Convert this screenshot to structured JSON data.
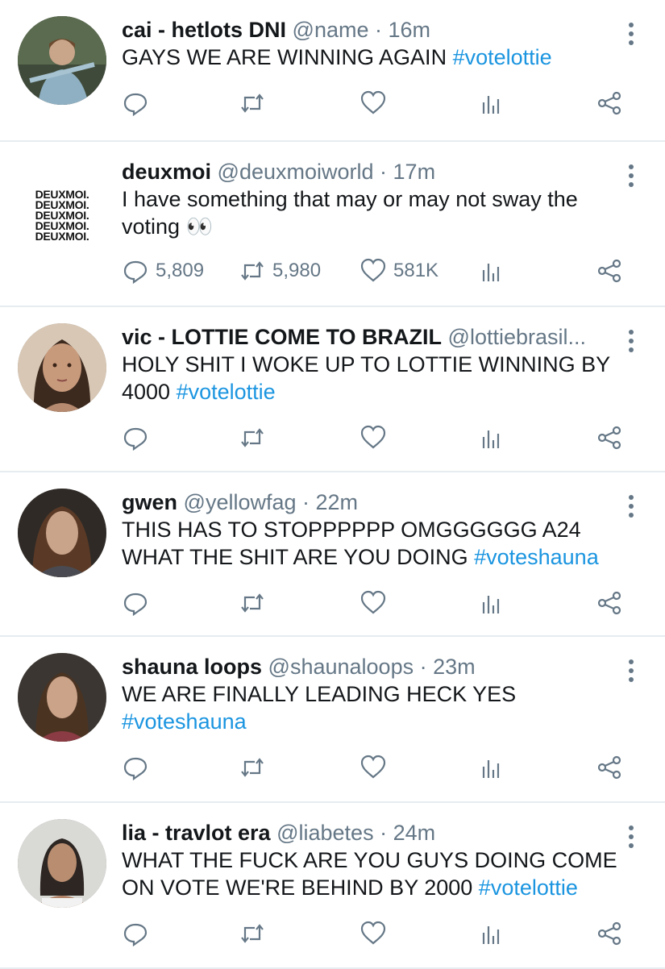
{
  "tweets": [
    {
      "name": "cai - hetlots DNI",
      "handle": "@name",
      "time": "· 16m",
      "text_parts": [
        "GAYS WE ARE WINNING AGAIN ",
        "#votelottie"
      ],
      "counts": {
        "reply": "",
        "retweet": "",
        "like": ""
      },
      "avatar": "photo"
    },
    {
      "name": "deuxmoi",
      "handle": "@deuxmoiworld",
      "time": "· 17m",
      "text_parts": [
        "I have something that may or may not sway the voting 👀",
        ""
      ],
      "counts": {
        "reply": "5,809",
        "retweet": "5,980",
        "like": "581K"
      },
      "avatar": "logo",
      "logo_lines": [
        "DEUXMOI.",
        "DEUXMOI.",
        "DEUXMOI.",
        "DEUXMOI.",
        "DEUXMOI."
      ]
    },
    {
      "name": "vic - LOTTIE COME TO BRAZIL",
      "handle": "@lottiebrasil...",
      "time": "",
      "text_parts": [
        "HOLY SHIT I WOKE UP TO LOTTIE WINNING BY 4000 ",
        "#votelottie"
      ],
      "counts": {
        "reply": "",
        "retweet": "",
        "like": ""
      },
      "avatar": "photo"
    },
    {
      "name": "gwen",
      "handle": "@yellowfag",
      "time": "· 22m",
      "text_parts": [
        "THIS HAS TO STOPPPPPP OMGGGGGG A24 WHAT THE SHIT ARE YOU DOING ",
        "#voteshauna"
      ],
      "counts": {
        "reply": "",
        "retweet": "",
        "like": ""
      },
      "avatar": "photo"
    },
    {
      "name": "shauna loops",
      "handle": "@shaunaloops",
      "time": "· 23m",
      "text_parts": [
        "WE ARE FINALLY LEADING HECK YES ",
        "#voteshauna"
      ],
      "counts": {
        "reply": "",
        "retweet": "",
        "like": ""
      },
      "avatar": "photo"
    },
    {
      "name": "lia - travlot era",
      "handle": "@liabetes",
      "time": "· 24m",
      "text_parts": [
        "WHAT THE FUCK ARE YOU GUYS DOING COME ON VOTE WE'RE BEHIND BY 2000 ",
        "#votelottie"
      ],
      "counts": {
        "reply": "",
        "retweet": "",
        "like": ""
      },
      "avatar": "photo"
    }
  ],
  "icons": {
    "reply": "reply-icon",
    "retweet": "retweet-icon",
    "like": "heart-icon",
    "stats": "analytics-icon",
    "share": "share-icon",
    "more": "more-options-icon"
  },
  "colors": {
    "hashtag": "#1b95e0",
    "meta": "#657786",
    "divider": "#e6ecf0"
  }
}
